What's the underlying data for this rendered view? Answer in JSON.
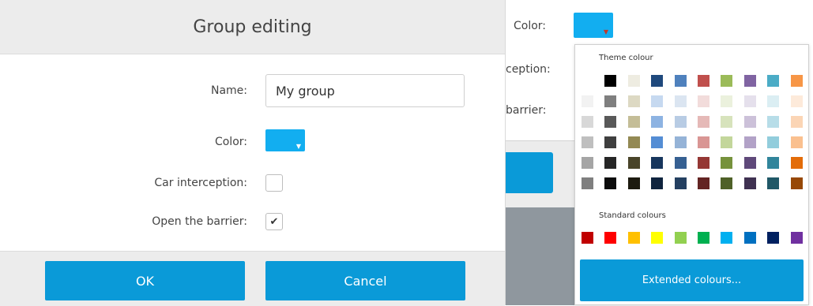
{
  "dialog": {
    "title": "Group editing",
    "name_label": "Name:",
    "name_value": "My group",
    "color_label": "Color:",
    "color_value": "#12aef0",
    "car_interception_label": "Car interception:",
    "car_interception_checked": false,
    "open_barrier_label": "Open the barrier:",
    "open_barrier_checked": true,
    "ok_label": "OK",
    "cancel_label": "Cancel"
  },
  "behind": {
    "color_label": "Color:",
    "interception_partial": "ception:",
    "barrier_partial": "barrier:"
  },
  "color_picker": {
    "theme_title": "Theme colour",
    "standard_title": "Standard colours",
    "extended_label": "Extended colours...",
    "theme_colors": [
      [
        "#ffffff",
        "#000000",
        "#eeece1",
        "#1f497d",
        "#4f81bd",
        "#c0504d",
        "#9bbb59",
        "#8064a2",
        "#4bacc6",
        "#f79646"
      ],
      [
        "#f2f2f2",
        "#7f7f7f",
        "#ddd9c3",
        "#c6d9f0",
        "#dbe5f1",
        "#f2dcdb",
        "#ebf1dd",
        "#e5e0ec",
        "#dbeef3",
        "#fdeada"
      ],
      [
        "#d8d8d8",
        "#595959",
        "#c4bd97",
        "#8db3e2",
        "#b8cce4",
        "#e5b9b7",
        "#d7e3bc",
        "#ccc1d9",
        "#b7dde8",
        "#fbd5b5"
      ],
      [
        "#bfbfbf",
        "#3f3f3f",
        "#938953",
        "#548dd4",
        "#95b3d7",
        "#d99694",
        "#c3d69b",
        "#b2a2c7",
        "#92cddc",
        "#fac08f"
      ],
      [
        "#a5a5a5",
        "#262626",
        "#494429",
        "#17365d",
        "#366092",
        "#953734",
        "#76923c",
        "#5f497a",
        "#31859b",
        "#e36c09"
      ],
      [
        "#7f7f7f",
        "#0c0c0c",
        "#1d1b10",
        "#0f243e",
        "#244061",
        "#632423",
        "#4f6128",
        "#3f3151",
        "#205867",
        "#974806"
      ]
    ],
    "standard_colors": [
      "#c00000",
      "#ff0000",
      "#ffc000",
      "#ffff00",
      "#92d050",
      "#00b050",
      "#00b0f0",
      "#0070c0",
      "#002060",
      "#7030a0"
    ]
  }
}
